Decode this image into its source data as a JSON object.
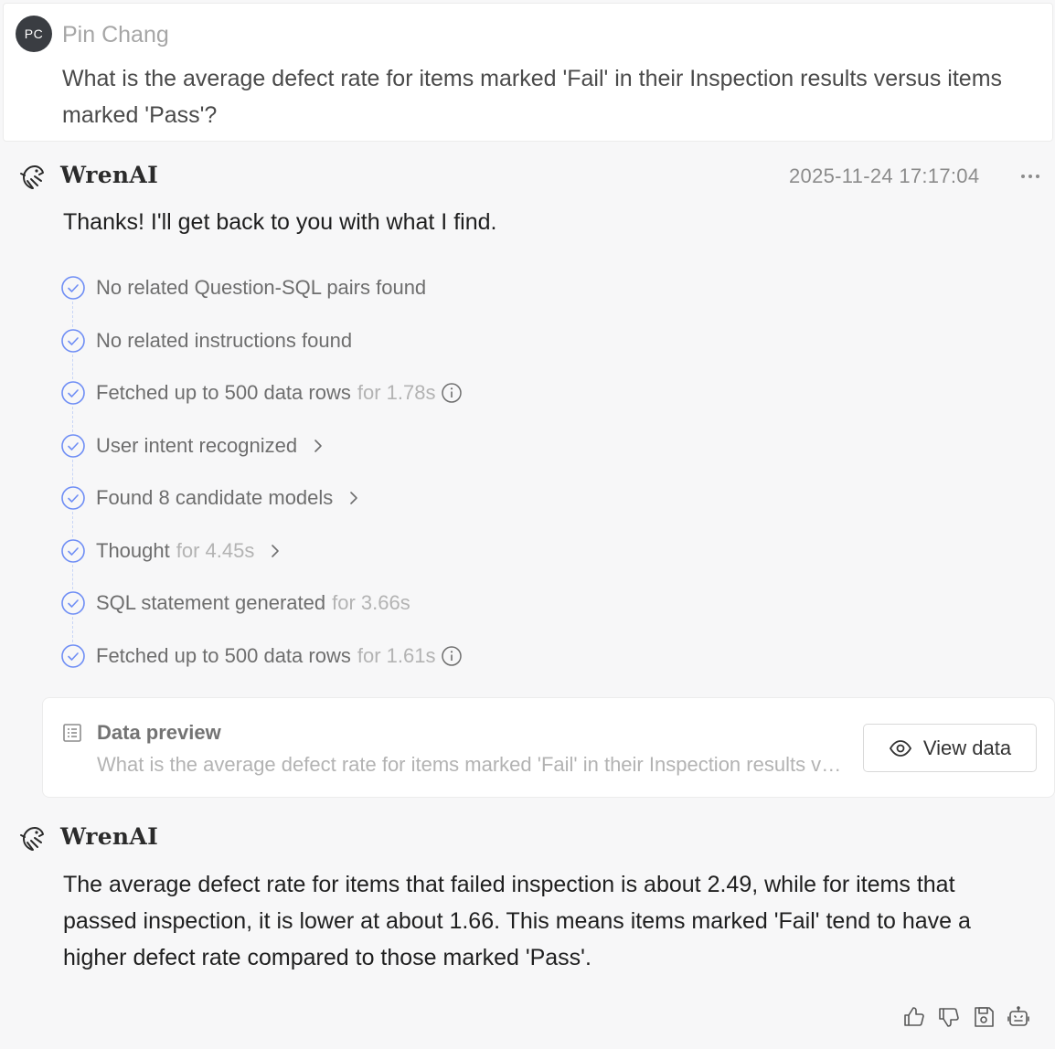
{
  "user": {
    "avatar_initials": "PC",
    "name": "Pin Chang",
    "question": "What is the average defect rate for items marked 'Fail' in their Inspection results versus items marked 'Pass'?"
  },
  "assistant": {
    "name": "WrenAI",
    "timestamp": "2025-11-24 17:17:04",
    "ack": "Thanks! I'll get back to you with what I find.",
    "steps": [
      {
        "label": "No related Question-SQL pairs found",
        "duration": "",
        "has_info": false,
        "has_chevron": false
      },
      {
        "label": "No related instructions found",
        "duration": "",
        "has_info": false,
        "has_chevron": false
      },
      {
        "label": "Fetched up to 500 data rows",
        "duration": "for 1.78s",
        "has_info": true,
        "has_chevron": false
      },
      {
        "label": "User intent recognized",
        "duration": "",
        "has_info": false,
        "has_chevron": true
      },
      {
        "label": "Found 8 candidate models",
        "duration": "",
        "has_info": false,
        "has_chevron": true
      },
      {
        "label": "Thought",
        "duration": "for 4.45s",
        "has_info": false,
        "has_chevron": true
      },
      {
        "label": "SQL statement generated",
        "duration": "for 3.66s",
        "has_info": false,
        "has_chevron": false
      },
      {
        "label": "Fetched up to 500 data rows",
        "duration": "for 1.61s",
        "has_info": true,
        "has_chevron": false
      }
    ],
    "preview": {
      "title": "Data preview",
      "subtitle": "What is the average defect rate for items marked 'Fail' in their Inspection results versus items marked 'Pass'?",
      "button_label": "View data"
    },
    "answer_name": "WrenAI",
    "answer": "The average defect rate for items that failed inspection is about 2.49, while for items that passed inspection, it is lower at about 1.66. This means items marked 'Fail' tend to have a higher defect rate compared to those marked 'Pass'."
  },
  "actions": [
    {
      "name": "thumbs-up-icon"
    },
    {
      "name": "thumbs-down-icon"
    },
    {
      "name": "save-icon"
    },
    {
      "name": "robot-icon"
    }
  ],
  "colors": {
    "accent": "#6f8ef5",
    "background": "#f7f7f8",
    "muted_text": "#6e6e6e",
    "faint_text": "#b3b3b3"
  }
}
